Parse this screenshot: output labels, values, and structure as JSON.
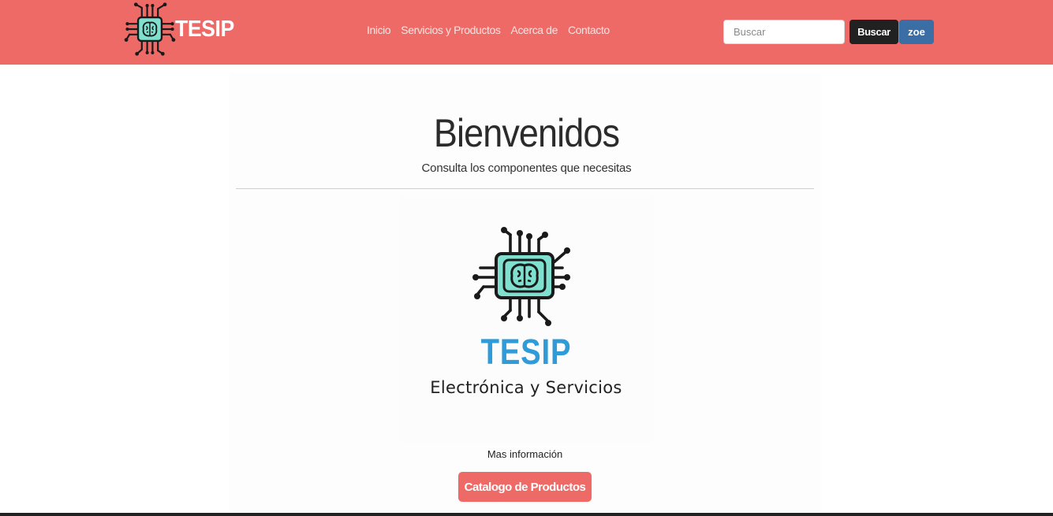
{
  "navbar": {
    "brand": "TESIP",
    "links": [
      "Inicio",
      "Servicios y Productos",
      "Acerca de",
      "Contacto"
    ],
    "search_placeholder": "Buscar",
    "search_button": "Buscar",
    "user_button": "zoe",
    "color": "#ee6a67"
  },
  "hero": {
    "title": "Bienvenidos",
    "subtitle": "Consulta los componentes que necesitas"
  },
  "logo_image": {
    "brand": "TESIP",
    "tagline": "Electrónica y Servicios",
    "accent_color": "#2f9bd8",
    "icon": "chip-brain-icon"
  },
  "more_info": "Mas información",
  "catalog_button": "Catalogo de Productos"
}
